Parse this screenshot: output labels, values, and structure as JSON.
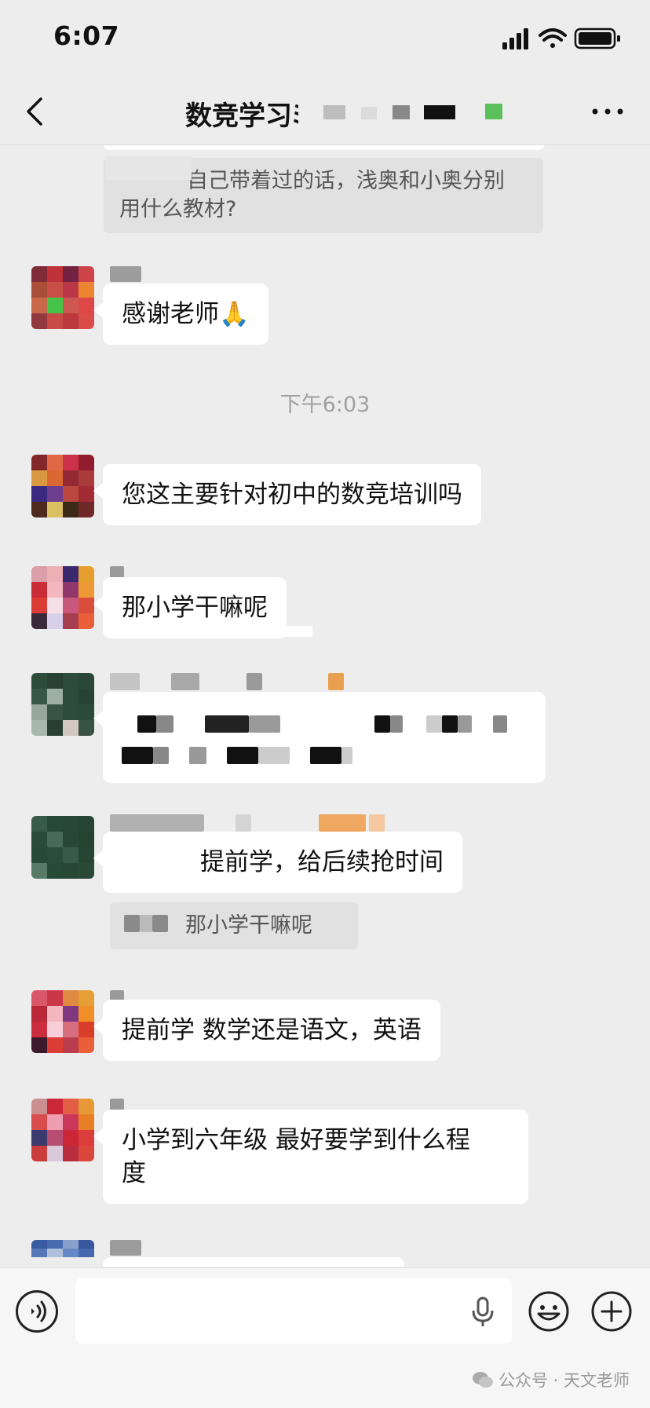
{
  "status_bar": {
    "time": "6:07"
  },
  "nav": {
    "title": "数竞学习ﾐ"
  },
  "chat": {
    "top_quote": {
      "line1": "自己带着过的话，浅奥和小奥分别",
      "line2": "用什么教材?"
    },
    "messages": [
      {
        "text": "感谢老师",
        "emoji": "🙏"
      },
      {
        "text": "您这主要针对初中的数竞培训吗"
      },
      {
        "text": "那小学干嘛呢"
      },
      {
        "text": "提前学，给后续抢时间",
        "quote": "那小学干嘛呢"
      },
      {
        "text": "提前学 数学还是语文，英语"
      },
      {
        "line1": "小学到六年级 最好要学到什么程",
        "line2": "度"
      }
    ],
    "time_separator": "下午6:03"
  },
  "input_bar": {
    "placeholder": ""
  },
  "watermark": {
    "text": "公众号 · 天文老师"
  },
  "colors": {
    "background": "#ededed",
    "bubble": "#ffffff",
    "quote": "#e1e1e1"
  },
  "icons": [
    "back-arrow-icon",
    "more-dots-icon",
    "signal-icon",
    "wifi-icon",
    "battery-icon",
    "voice-icon",
    "mic-icon",
    "emoji-icon",
    "plus-icon",
    "wechat-icon"
  ]
}
